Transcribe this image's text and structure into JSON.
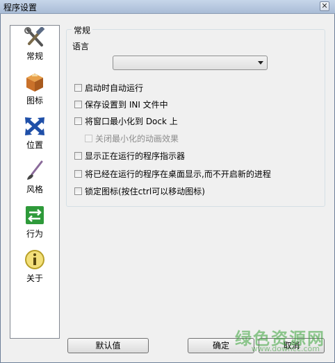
{
  "window": {
    "title": "程序设置",
    "close_glyph": "✕"
  },
  "sidebar": {
    "items": [
      {
        "label": "常规",
        "icon": "tools-icon"
      },
      {
        "label": "图标",
        "icon": "box-icon"
      },
      {
        "label": "位置",
        "icon": "arrows-icon"
      },
      {
        "label": "风格",
        "icon": "brush-icon"
      },
      {
        "label": "行为",
        "icon": "exchange-icon"
      },
      {
        "label": "关于",
        "icon": "info-icon"
      }
    ]
  },
  "general": {
    "group_title": "常规",
    "language_label": "语言",
    "language_value": "",
    "options": [
      {
        "label": "启动时自动运行",
        "checked": false,
        "enabled": true
      },
      {
        "label": "保存设置到 INI 文件中",
        "checked": false,
        "enabled": true
      },
      {
        "label": "将窗口最小化到 Dock 上",
        "checked": false,
        "enabled": true
      },
      {
        "label": "关闭最小化的动画效果",
        "checked": false,
        "enabled": false
      },
      {
        "label": "显示正在运行的程序指示器",
        "checked": false,
        "enabled": true
      },
      {
        "label": "将已经在运行的程序在桌面显示,而不开启新的进程",
        "checked": false,
        "enabled": true
      },
      {
        "label": "锁定图标(按住ctrl可以移动图标)",
        "checked": false,
        "enabled": true
      }
    ]
  },
  "buttons": {
    "default": "默认值",
    "ok": "确定",
    "cancel": "取消"
  },
  "watermark": {
    "text": "绿色资源网",
    "url": "www.downcc.com"
  },
  "colors": {
    "accent": "#3aa33a",
    "titlebar": "#b9cbe2"
  }
}
